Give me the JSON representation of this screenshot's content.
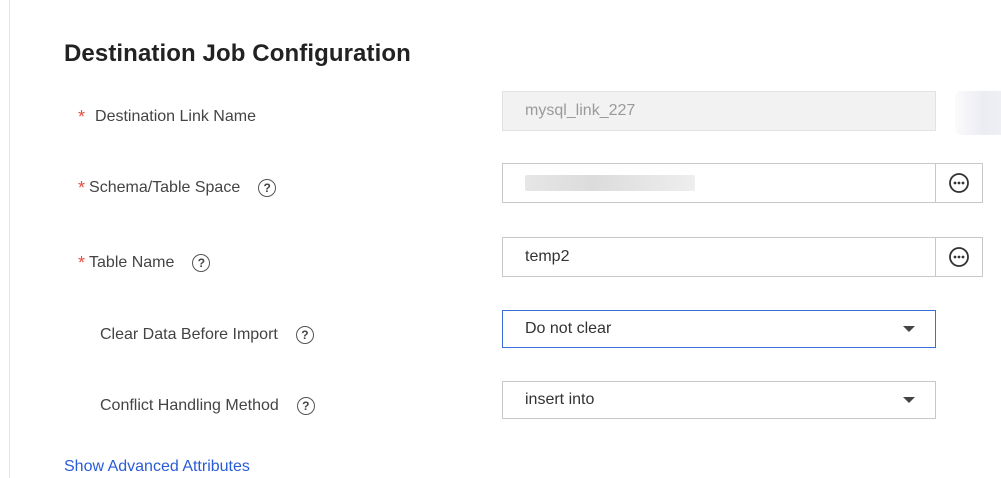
{
  "section": {
    "title": "Destination Job Configuration"
  },
  "fields": {
    "link_name": {
      "label": "Destination Link Name",
      "value": "mysql_link_227",
      "required": true,
      "disabled": true
    },
    "schema": {
      "label": "Schema/Table Space",
      "value": "",
      "required": true
    },
    "table_name": {
      "label": "Table Name",
      "value": "temp2",
      "required": true
    },
    "clear_data": {
      "label": "Clear Data Before Import",
      "selected": "Do not clear"
    },
    "conflict": {
      "label": "Conflict Handling Method",
      "selected": "insert into"
    }
  },
  "glyphs": {
    "required": "*",
    "help": "?"
  },
  "advanced_link": "Show Advanced Attributes",
  "colors": {
    "required_star": "#e84e40",
    "link": "#2a5bd7",
    "focused_border": "#3a6fd8"
  }
}
